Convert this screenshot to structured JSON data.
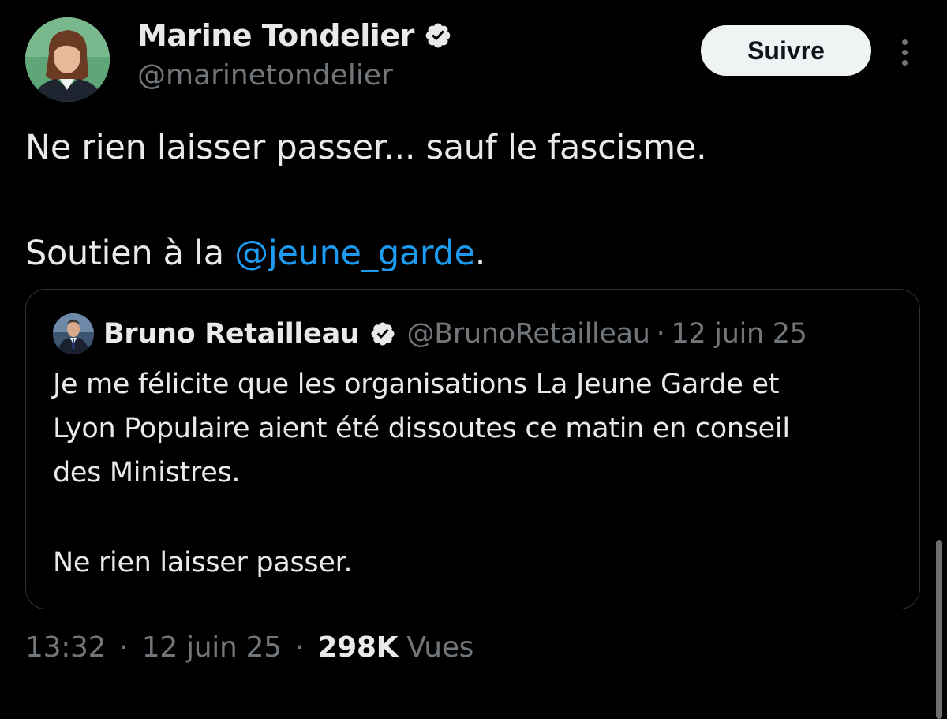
{
  "author": {
    "name": "Marine Tondelier",
    "handle": "@marinetondelier",
    "avatar_icon": "user-avatar",
    "verified_icon": "verified-badge-icon"
  },
  "follow_button": {
    "label": "Suivre"
  },
  "more_icon": "more-vertical-icon",
  "tweet": {
    "line1": "Ne rien laisser passer... sauf le fascisme.",
    "line2_prefix": "Soutien à la ",
    "mention": "@jeune_garde",
    "line2_suffix": "."
  },
  "quoted_tweet": {
    "author_name": "Bruno Retailleau",
    "handle": "@BrunoRetailleau",
    "separator": "·",
    "date": "12 juin 25",
    "lines": [
      "Je me félicite que les organisations La Jeune Garde et",
      "Lyon Populaire aient été dissoutes ce matin en conseil",
      "des Ministres.",
      "Ne rien laisser passer."
    ]
  },
  "meta": {
    "time": "13:32",
    "separator": "·",
    "date": "12 juin 25",
    "views_count": "298K",
    "views_label": "Vues"
  },
  "colors": {
    "background": "#000000",
    "text_primary": "#e7e9ea",
    "text_secondary": "#71767b",
    "accent_link": "#1d9bf0",
    "border": "#2f3336",
    "follow_bg": "#eff3f4"
  }
}
